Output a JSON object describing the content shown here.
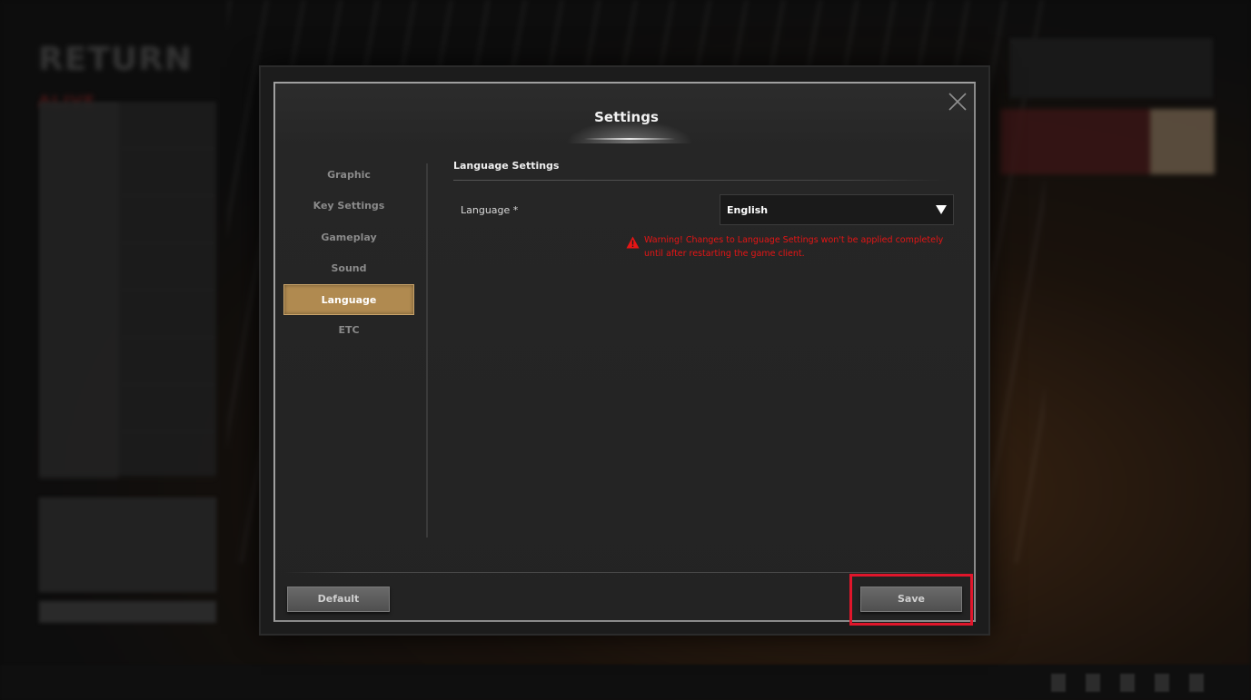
{
  "dialog": {
    "title": "Settings",
    "sidebar": {
      "items": [
        {
          "label": "Graphic"
        },
        {
          "label": "Key Settings"
        },
        {
          "label": "Gameplay"
        },
        {
          "label": "Sound"
        },
        {
          "label": "Language",
          "active": true
        },
        {
          "label": "ETC"
        }
      ]
    },
    "section": {
      "title": "Language Settings",
      "language_label": "Language *",
      "language_value": "English",
      "warning_line1": "Warning! Changes to Language Settings won't be applied completely",
      "warning_line2": "until after restarting the game client."
    },
    "footer": {
      "default_label": "Default",
      "save_label": "Save"
    }
  },
  "icons": {
    "close": "close-icon",
    "dropdown": "chevron-down-icon",
    "warning": "warning-icon"
  },
  "colors": {
    "active_tab": "#b08a50",
    "warning_text": "#e61515",
    "highlight_box": "#e0162b"
  }
}
